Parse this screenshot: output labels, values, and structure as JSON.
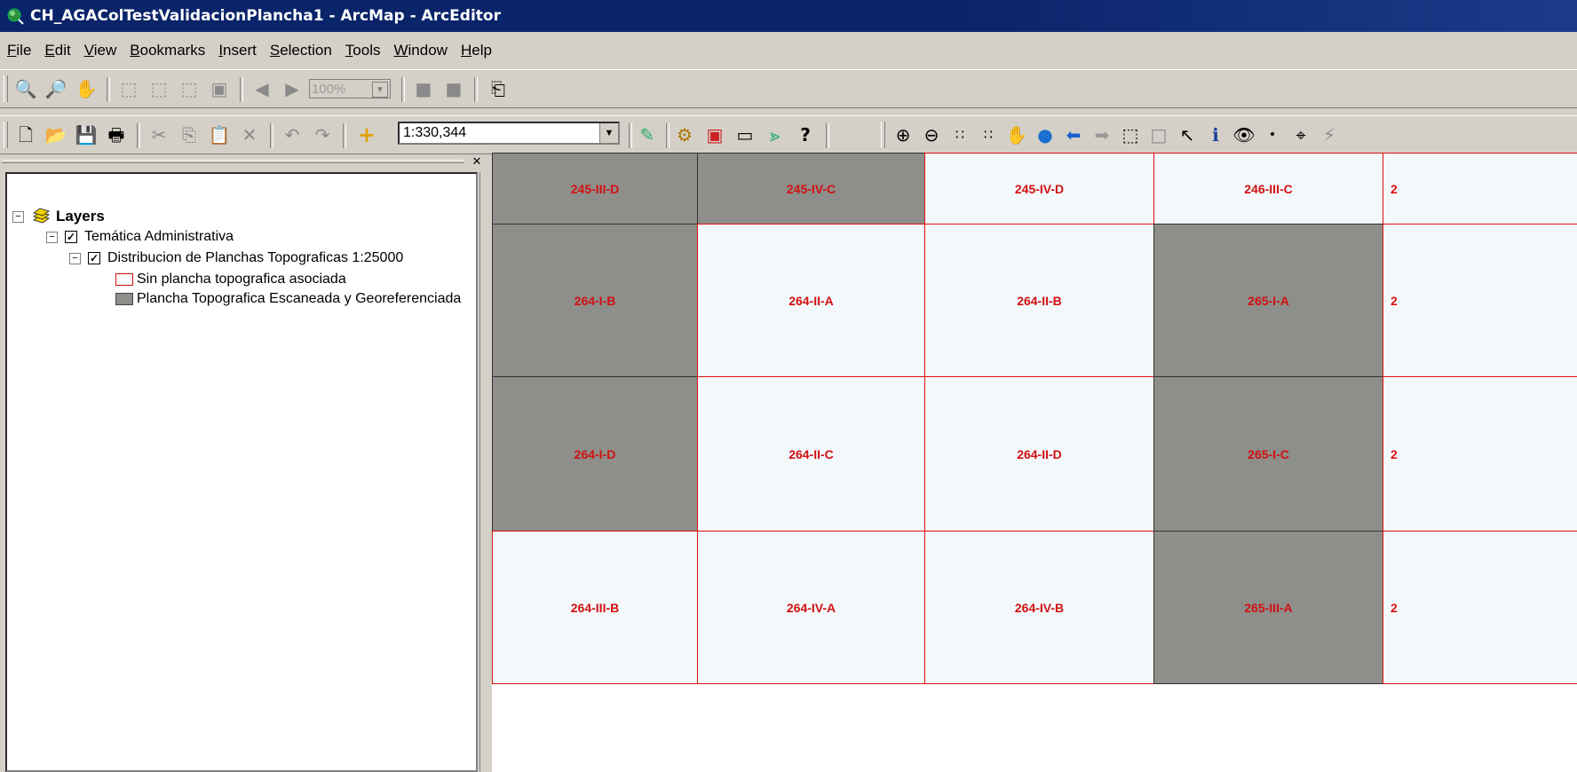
{
  "window": {
    "title": "CH_AGAColTestValidacionPlancha1 - ArcMap - ArcEditor"
  },
  "menu": [
    "File",
    "Edit",
    "View",
    "Bookmarks",
    "Insert",
    "Selection",
    "Tools",
    "Window",
    "Help"
  ],
  "menu_mnemonics": [
    "F",
    "E",
    "V",
    "B",
    "I",
    "S",
    "T",
    "W",
    "H"
  ],
  "toolbar_layout": {
    "zoom_value": "100%"
  },
  "toolbar_standard": {
    "scale_value": "1:330,344"
  },
  "toc": {
    "root_label": "Layers",
    "group_label": "Temática Administrativa",
    "layer_label": "Distribucion de Planchas Topograficas 1:25000",
    "legend": [
      {
        "label": "Sin plancha topografica asociada",
        "fill": "#ffffff",
        "stroke": "#d11111"
      },
      {
        "label": "Plancha Topografica Escaneada y Georeferenciada",
        "fill": "#8e8e8a",
        "stroke": "#444444"
      }
    ]
  },
  "map": {
    "label_color": "#d11111",
    "rows": [
      [
        {
          "label": "245-III-D",
          "type": "scan"
        },
        {
          "label": "245-IV-C",
          "type": "scan"
        },
        {
          "label": "245-IV-D",
          "type": "none"
        },
        {
          "label": "246-III-C",
          "type": "none"
        }
      ],
      [
        {
          "label": "264-I-B",
          "type": "scan"
        },
        {
          "label": "264-II-A",
          "type": "none"
        },
        {
          "label": "264-II-B",
          "type": "none"
        },
        {
          "label": "265-I-A",
          "type": "scan"
        }
      ],
      [
        {
          "label": "264-I-D",
          "type": "scan"
        },
        {
          "label": "264-II-C",
          "type": "none"
        },
        {
          "label": "264-II-D",
          "type": "none"
        },
        {
          "label": "265-I-C",
          "type": "scan"
        }
      ],
      [
        {
          "label": "264-III-B",
          "type": "none"
        },
        {
          "label": "264-IV-A",
          "type": "none"
        },
        {
          "label": "264-IV-B",
          "type": "none"
        },
        {
          "label": "265-III-A",
          "type": "scan"
        }
      ]
    ],
    "edge_labels": [
      "2",
      "2",
      "2",
      "2"
    ]
  }
}
